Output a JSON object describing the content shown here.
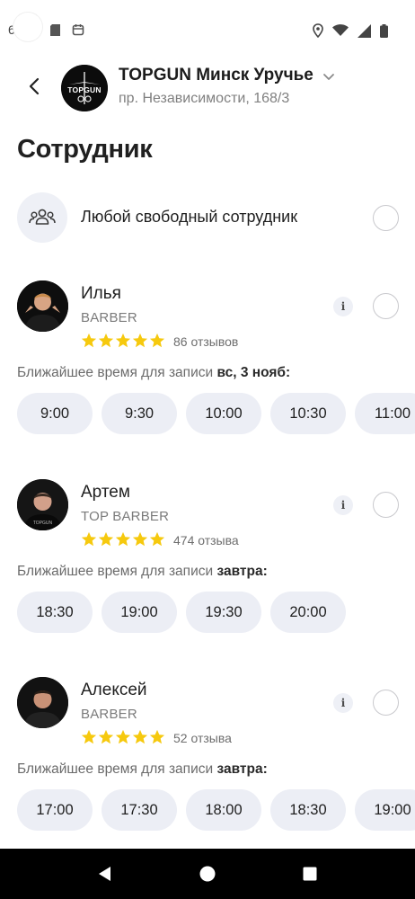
{
  "status_bar": {
    "left_text": "6",
    "icons": [
      "sd-card-icon",
      "calendar-icon",
      "location-icon",
      "wifi-icon",
      "cellular-icon",
      "battery-icon"
    ]
  },
  "header": {
    "salon_name": "TOPGUN Минск Уручье",
    "salon_address": "пр. Независимости, 168/3",
    "logo_text": "TOPGUN"
  },
  "page_title": "Сотрудник",
  "any_employee": {
    "label": "Любой свободный сотрудник"
  },
  "employees": [
    {
      "name": "Илья",
      "role": "BARBER",
      "rating": 5,
      "reviews": "86 отзывов",
      "nearest_prefix": "Ближайшее время для записи",
      "nearest_day": "вс, 3 нояб:",
      "slots": [
        "9:00",
        "9:30",
        "10:00",
        "10:30",
        "11:00"
      ]
    },
    {
      "name": "Артем",
      "role": "TOP BARBER",
      "rating": 5,
      "reviews": "474 отзыва",
      "nearest_prefix": "Ближайшее время для записи",
      "nearest_day": "завтра:",
      "slots": [
        "18:30",
        "19:00",
        "19:30",
        "20:00"
      ]
    },
    {
      "name": "Алексей",
      "role": "BARBER",
      "rating": 5,
      "reviews": "52 отзыва",
      "nearest_prefix": "Ближайшее время для записи",
      "nearest_day": "завтра:",
      "slots": [
        "17:00",
        "17:30",
        "18:00",
        "18:30",
        "19:00"
      ]
    }
  ],
  "colors": {
    "star": "#f6c90e",
    "slot_bg": "#eceef5",
    "avatar_bg": "#111111"
  }
}
